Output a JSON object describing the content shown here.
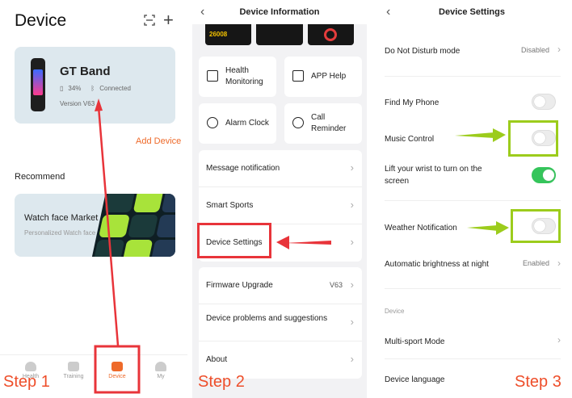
{
  "panel1": {
    "title": "Device",
    "device": {
      "name": "GT Band",
      "battery": "34%",
      "status": "Connected",
      "version": "Version V63"
    },
    "add_device": "Add Device",
    "recommend": "Recommend",
    "watch_face": {
      "title": "Watch face Market",
      "subtitle": "Personalized Watch face"
    },
    "tabs": [
      {
        "label": "Health",
        "icon": "heart-icon"
      },
      {
        "label": "Training",
        "icon": "run-icon"
      },
      {
        "label": "Device",
        "icon": "watch-icon",
        "active": true
      },
      {
        "label": "My",
        "icon": "user-icon"
      }
    ]
  },
  "panel2": {
    "title": "Device Information",
    "thumb_text": "26008",
    "functions": [
      {
        "label": "Health Monitoring",
        "icon": "monitor-icon"
      },
      {
        "label": "APP Help",
        "icon": "help-icon"
      },
      {
        "label": "Alarm Clock",
        "icon": "alarm-icon"
      },
      {
        "label": "Call Reminder",
        "icon": "phone-icon"
      }
    ],
    "menu1": [
      "Message notification",
      "Smart Sports",
      "Device Settings"
    ],
    "menu2": [
      {
        "label": "Firmware Upgrade",
        "value": "V63"
      },
      {
        "label": "Device problems and suggestions",
        "value": ""
      },
      {
        "label": "About",
        "value": ""
      }
    ]
  },
  "panel3": {
    "title": "Device Settings",
    "rows": [
      {
        "label": "Do Not Disturb mode",
        "value": "Disabled"
      },
      {
        "label": "Find My Phone",
        "toggle": false
      },
      {
        "label": "Music Control",
        "toggle": false
      },
      {
        "label": "Lift your wrist to turn on the screen",
        "toggle": true
      },
      {
        "label": "Weather Notification",
        "toggle": false
      },
      {
        "label": "Automatic brightness at night",
        "value": "Enabled"
      }
    ],
    "section": "Device",
    "rows2": [
      {
        "label": "Multi-sport Mode"
      },
      {
        "label": "Device language"
      }
    ]
  },
  "steps": [
    "Step 1",
    "Step 2",
    "Step 3"
  ],
  "colors": {
    "accent": "#ee6a2a",
    "step_red": "#e8343a",
    "arrow_green": "#9ccc1c",
    "toggle_on": "#35c55b"
  }
}
